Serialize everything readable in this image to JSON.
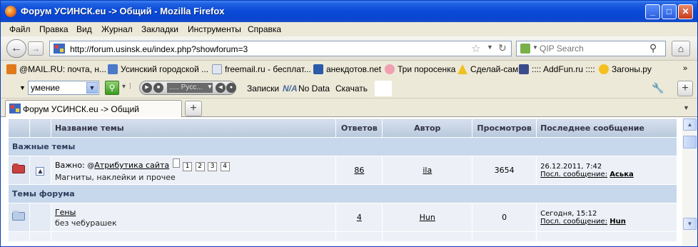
{
  "window": {
    "title": "Форум УСИНСК.eu -> Общий - Mozilla Firefox",
    "buttons": {
      "minimize": "_",
      "maximize": "□",
      "close": "✕"
    }
  },
  "menu": [
    "Файл",
    "Правка",
    "Вид",
    "Журнал",
    "Закладки",
    "Инструменты",
    "Справка"
  ],
  "nav": {
    "url": "http://forum.usinsk.eu/index.php?showforum=3",
    "search_placeholder": "QIP Search"
  },
  "bookmarks": [
    {
      "label": "@MAIL.RU: почта, н...",
      "color": "#e07a1a"
    },
    {
      "label": "Усинский городской ...",
      "color": "#4a7ac8"
    },
    {
      "label": "freemail.ru - бесплат...",
      "color": "#dfe6f0"
    },
    {
      "label": "анекдотов.net",
      "color": "#2a5aa8"
    },
    {
      "label": "Три поросенка",
      "color": "#f0a0b0"
    },
    {
      "label": "Сделай-сам",
      "color": "#f0c020"
    },
    {
      "label": ":::: AddFun.ru ::::",
      "color": "#3a4a8a"
    },
    {
      "label": "Загоны.ру",
      "color": "#f4c020"
    }
  ],
  "toolbar2": {
    "select_value": "умение",
    "station": "..... Русс...",
    "items": [
      "Записки",
      "N/A",
      "No Data",
      "Скачать"
    ]
  },
  "tabs": [
    {
      "label": "Форум УСИНСК.eu -> Общий"
    }
  ],
  "forum": {
    "headers": [
      "Название темы",
      "Ответов",
      "Автор",
      "Просмотров",
      "Последнее сообщение"
    ],
    "sections": [
      {
        "title": "Важные темы",
        "topics": [
          {
            "prefix": "Важно:",
            "title": "Атрибутика сайта",
            "pages": [
              "1",
              "2",
              "3",
              "4"
            ],
            "desc": "Магниты, наклейки и прочее",
            "replies": "86",
            "author": "ila",
            "views": "3654",
            "last_date": "26.12.2011, 7:42",
            "last_label": "Посл. сообщение:",
            "last_author": "Аська"
          }
        ]
      },
      {
        "title": "Темы форума",
        "topics": [
          {
            "title": "Гены",
            "desc": "без чебурашек",
            "replies": "4",
            "author": "Hun",
            "views": "0",
            "last_date": "Сегодня, 15:12",
            "last_label": "Посл. сообщение:",
            "last_author": "Hun"
          }
        ]
      }
    ]
  }
}
